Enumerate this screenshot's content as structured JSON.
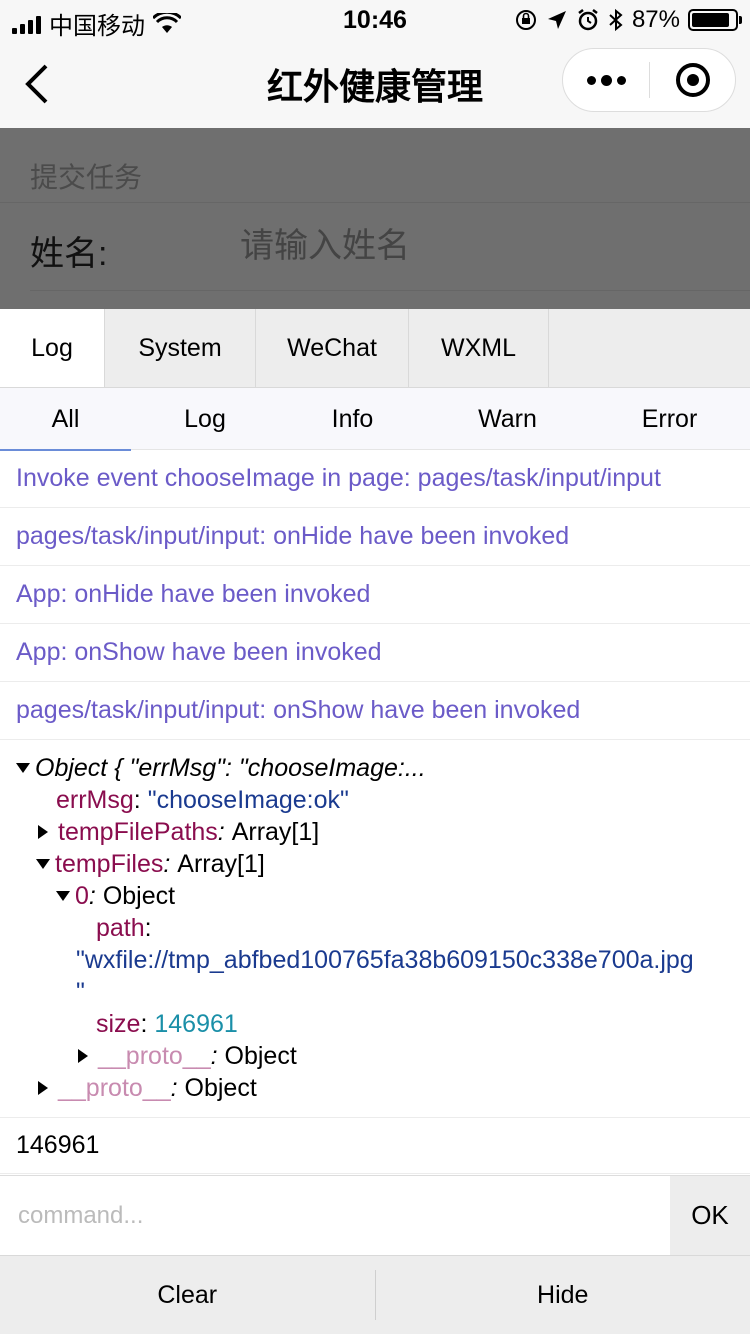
{
  "statusbar": {
    "carrier": "中国移动",
    "time": "10:46",
    "battery_text": "87%",
    "battery_level": 0.87
  },
  "navbar": {
    "title": "红外健康管理"
  },
  "page": {
    "section_title": "提交任务",
    "name_label": "姓名:",
    "name_placeholder": "请输入姓名"
  },
  "vconsole": {
    "tabs": [
      "Log",
      "System",
      "WeChat",
      "WXML"
    ],
    "subtabs": [
      "All",
      "Log",
      "Info",
      "Warn",
      "Error"
    ],
    "logs": [
      "Invoke event chooseImage in page: pages/task/input/input",
      "pages/task/input/input: onHide have been invoked",
      "App: onHide have been invoked",
      "App: onShow have been invoked",
      "pages/task/input/input: onShow have been invoked"
    ],
    "object": {
      "summary": "Object { \"errMsg\": \"chooseImage:...",
      "errMsg_key": "errMsg",
      "errMsg_value": "\"chooseImage:ok\"",
      "tempFilePaths_key": "tempFilePaths",
      "tempFilePaths_value": "Array[1]",
      "tempFiles_key": "tempFiles",
      "tempFiles_value": "Array[1]",
      "index_key": "0",
      "index_value": "Object",
      "path_key": "path",
      "path_value": "\"wxfile://tmp_abfbed100765fa38b609150c338e700a.jpg",
      "path_value_end": "\"",
      "size_key": "size",
      "size_value": "146961",
      "proto_key": "__proto__",
      "proto_value": "Object"
    },
    "result": "146961",
    "command_placeholder": "command...",
    "ok_label": "OK",
    "clear_label": "Clear",
    "hide_label": "Hide"
  }
}
